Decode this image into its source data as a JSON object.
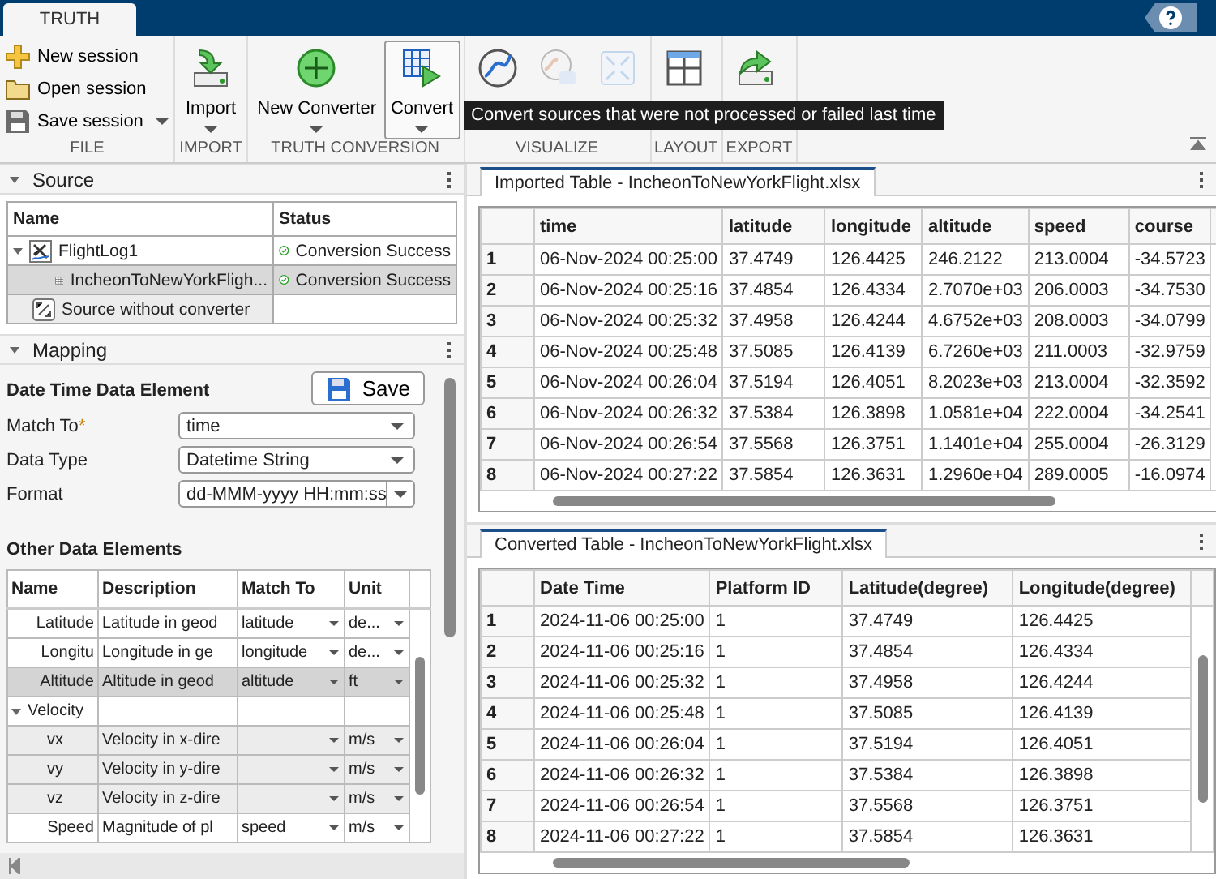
{
  "app_tabs": [
    {
      "label": "TRUTH",
      "selected": true
    }
  ],
  "toolbar": {
    "groups": [
      {
        "label": "FILE",
        "kind": "small",
        "items": [
          {
            "label": "New session",
            "dropdown": false
          },
          {
            "label": "Open session",
            "dropdown": false
          },
          {
            "label": "Save session",
            "dropdown": true
          }
        ]
      },
      {
        "label": "IMPORT",
        "kind": "large",
        "items": [
          {
            "label": "Import",
            "dropdown": true,
            "disabled": false,
            "pressed": false
          }
        ]
      },
      {
        "label": "TRUTH CONVERSION",
        "kind": "large",
        "items": [
          {
            "label": "New Converter",
            "dropdown": true,
            "disabled": false,
            "pressed": false
          },
          {
            "label": "Convert",
            "dropdown": true,
            "disabled": false,
            "pressed": true
          }
        ]
      },
      {
        "label": "VISUALIZE",
        "kind": "large",
        "items": [
          {
            "disabled": false,
            "pressed": false
          },
          {
            "disabled": true,
            "pressed": false
          },
          {
            "disabled": true,
            "pressed": false
          }
        ]
      },
      {
        "label": "LAYOUT",
        "kind": "large",
        "items": [
          {
            "disabled": false,
            "pressed": false
          }
        ]
      },
      {
        "label": "EXPORT",
        "kind": "large",
        "items": [
          {
            "disabled": false,
            "pressed": false
          }
        ]
      }
    ]
  },
  "tooltip": "Convert sources that were not processed or failed last time",
  "source": {
    "title": "Source",
    "columns": [
      "Name",
      "Status"
    ],
    "items": [
      {
        "kind": "log",
        "name": "FlightLog1",
        "status": "Conversion Success",
        "expanded": true,
        "selected": false,
        "children": [
          {
            "kind": "table",
            "name": "IncheonToNewYorkFligh...",
            "status": "Conversion Success",
            "selected": true
          }
        ]
      },
      {
        "kind": "unconverted",
        "name": "Source without converter",
        "selected": false
      }
    ]
  },
  "mapping": {
    "title": "Mapping",
    "section": "Date Time Data Element",
    "save": "Save",
    "fields": [
      {
        "label": "Match To",
        "required_mark": "*",
        "value": "time",
        "kind": "dropdown"
      },
      {
        "label": "Data Type",
        "value": "Datetime String",
        "kind": "dropdown"
      },
      {
        "label": "Format",
        "value": "dd-MMM-yyyy HH:mm:ss",
        "kind": "combo"
      }
    ],
    "other_title": "Other Data Elements",
    "columns": [
      "Name",
      "Description",
      "Match To",
      "Unit"
    ],
    "rows": [
      {
        "kind": "element",
        "name": "Latitude",
        "description": "Latitude in geod",
        "match_to": "latitude",
        "unit": "de...",
        "selected": false,
        "unmatched": false
      },
      {
        "kind": "element",
        "name": "Longitu",
        "description": "Longitude in ge",
        "match_to": "longitude",
        "unit": "de...",
        "selected": false,
        "unmatched": false
      },
      {
        "kind": "element",
        "name": "Altitude",
        "description": "Altitude in geod",
        "match_to": "altitude",
        "unit": "ft",
        "selected": true,
        "unmatched": false
      },
      {
        "kind": "group",
        "name": "Velocity",
        "expanded": true,
        "children": [
          {
            "name": "vx",
            "description": "Velocity in x-dire",
            "unit": "m/s",
            "selected": false,
            "unmatched": true
          },
          {
            "name": "vy",
            "description": "Velocity in y-dire",
            "unit": "m/s",
            "selected": false,
            "unmatched": true
          },
          {
            "name": "vz",
            "description": "Velocity in z-dire",
            "unit": "m/s",
            "selected": false,
            "unmatched": true
          }
        ]
      },
      {
        "kind": "element",
        "name": "Speed",
        "description": "Magnitude of pl",
        "match_to": "speed",
        "unit": "m/s",
        "selected": false,
        "unmatched": false
      }
    ]
  },
  "imported": {
    "title": "Imported Table - IncheonToNewYorkFlight.xlsx",
    "columns": [
      "time",
      "latitude",
      "longitude",
      "altitude",
      "speed",
      "course"
    ],
    "rows": [
      {
        "index": "1",
        "cells": [
          "06-Nov-2024 00:25:00",
          "37.4749",
          "126.4425",
          "246.2122",
          "213.0004",
          "-34.5723"
        ]
      },
      {
        "index": "2",
        "cells": [
          "06-Nov-2024 00:25:16",
          "37.4854",
          "126.4334",
          "2.7070e+03",
          "206.0003",
          "-34.7530"
        ]
      },
      {
        "index": "3",
        "cells": [
          "06-Nov-2024 00:25:32",
          "37.4958",
          "126.4244",
          "4.6752e+03",
          "208.0003",
          "-34.0799"
        ]
      },
      {
        "index": "4",
        "cells": [
          "06-Nov-2024 00:25:48",
          "37.5085",
          "126.4139",
          "6.7260e+03",
          "211.0003",
          "-32.9759"
        ]
      },
      {
        "index": "5",
        "cells": [
          "06-Nov-2024 00:26:04",
          "37.5194",
          "126.4051",
          "8.2023e+03",
          "213.0004",
          "-32.3592"
        ]
      },
      {
        "index": "6",
        "cells": [
          "06-Nov-2024 00:26:32",
          "37.5384",
          "126.3898",
          "1.0581e+04",
          "222.0004",
          "-34.2541"
        ]
      },
      {
        "index": "7",
        "cells": [
          "06-Nov-2024 00:26:54",
          "37.5568",
          "126.3751",
          "1.1401e+04",
          "255.0004",
          "-26.3129"
        ]
      },
      {
        "index": "8",
        "cells": [
          "06-Nov-2024 00:27:22",
          "37.5854",
          "126.3631",
          "1.2960e+04",
          "289.0005",
          "-16.0974"
        ]
      }
    ]
  },
  "converted": {
    "title": "Converted Table - IncheonToNewYorkFlight.xlsx",
    "columns": [
      "Date Time",
      "Platform ID",
      "Latitude(degree)",
      "Longitude(degree)"
    ],
    "rows": [
      {
        "index": "1",
        "cells": [
          "2024-11-06 00:25:00",
          "1",
          "37.4749",
          "126.4425"
        ]
      },
      {
        "index": "2",
        "cells": [
          "2024-11-06 00:25:16",
          "1",
          "37.4854",
          "126.4334"
        ]
      },
      {
        "index": "3",
        "cells": [
          "2024-11-06 00:25:32",
          "1",
          "37.4958",
          "126.4244"
        ]
      },
      {
        "index": "4",
        "cells": [
          "2024-11-06 00:25:48",
          "1",
          "37.5085",
          "126.4139"
        ]
      },
      {
        "index": "5",
        "cells": [
          "2024-11-06 00:26:04",
          "1",
          "37.5194",
          "126.4051"
        ]
      },
      {
        "index": "6",
        "cells": [
          "2024-11-06 00:26:32",
          "1",
          "37.5384",
          "126.3898"
        ]
      },
      {
        "index": "7",
        "cells": [
          "2024-11-06 00:26:54",
          "1",
          "37.5568",
          "126.3751"
        ]
      },
      {
        "index": "8",
        "cells": [
          "2024-11-06 00:27:22",
          "1",
          "37.5854",
          "126.3631"
        ]
      }
    ]
  }
}
